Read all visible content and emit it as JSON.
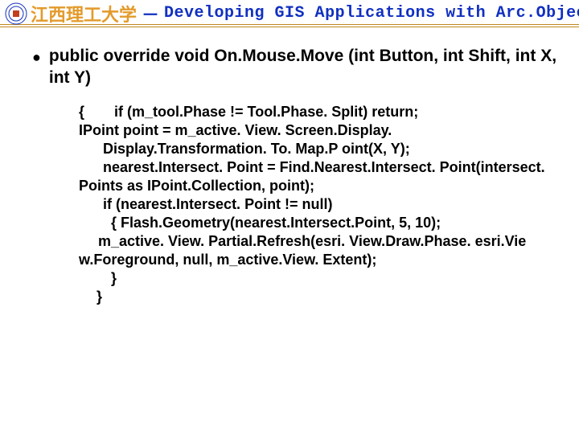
{
  "header": {
    "university": "江西理工大学",
    "dash": "－",
    "title": "Developing GIS Applications with Arc.Objects using C#. NE"
  },
  "bullet_glyph": "●",
  "signature": "public override void On.Mouse.Move (int Button, int Shift, int X, int Y)",
  "code": {
    "l1a": "{",
    "l1b": "if (m_tool.Phase != Tool.Phase. Split) return;",
    "l2": "IPoint point = m_active. View. Screen.Display. Display.Transformation. To. Map.P oint(X, Y);",
    "l3": "nearest.Intersect. Point = Find.Nearest.Intersect. Point(intersect. Points as IPoint.Collection, point);",
    "l4": "if (nearest.Intersect. Point != null)",
    "l5": "{   Flash.Geometry(nearest.Intersect.Point, 5, 10);",
    "l6": "m_active. View. Partial.Refresh(esri. View.Draw.Phase. esri.Vie w.Foreground, null, m_active.View. Extent);",
    "l7": "}",
    "l8": "}"
  }
}
